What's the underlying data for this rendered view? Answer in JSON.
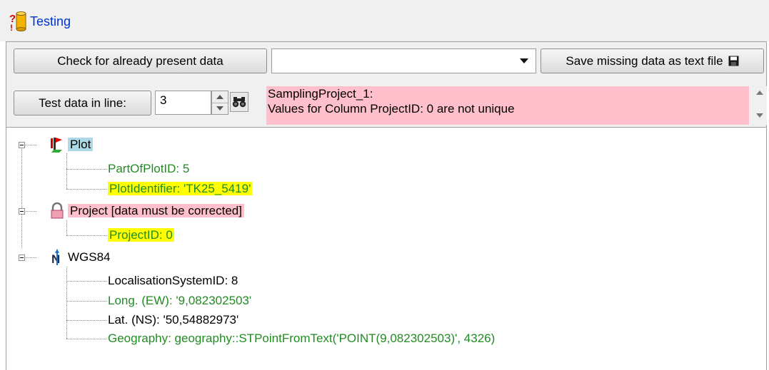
{
  "window": {
    "title": "Testing",
    "icon": "testing-icon"
  },
  "toolbar": {
    "check_button": "Check for already present data",
    "combo_value": "",
    "save_button": "Save missing data as text file",
    "save_icon": "floppy-disk-icon",
    "test_button": "Test data in line:",
    "line_value": "3",
    "find_icon": "binoculars-icon"
  },
  "message": {
    "line1": "SamplingProject_1:",
    "line2": "Values for  Column ProjectID: 0 are not unique",
    "background": "#ffc0cb"
  },
  "tree": {
    "nodes": [
      {
        "label": "Plot",
        "icon": "plot-flag-icon",
        "highlight": "#add8e6",
        "children": [
          {
            "label": "PartOfPlotID: 5",
            "color": "#228b22"
          },
          {
            "label": "PlotIdentifier: 'TK25_5419'",
            "color": "#228b22",
            "highlight": "#ffff00"
          }
        ]
      },
      {
        "label": "Project [data must be corrected]",
        "icon": "lock-icon",
        "highlight": "#ffc0cb",
        "children": [
          {
            "label": "ProjectID: 0",
            "color": "#228b22",
            "highlight": "#ffff00"
          }
        ]
      },
      {
        "label": "WGS84",
        "icon": "north-arrow-icon",
        "children": [
          {
            "label": "LocalisationSystemID: 8",
            "color": "#000000"
          },
          {
            "label": "Long. (EW): '9,082302503'",
            "color": "#228b22"
          },
          {
            "label": "Lat. (NS): '50,54882973'",
            "color": "#000000"
          },
          {
            "label": "Geography: geography::STPointFromText('POINT(9,082302503)', 4326)",
            "color": "#228b22"
          }
        ]
      }
    ]
  }
}
